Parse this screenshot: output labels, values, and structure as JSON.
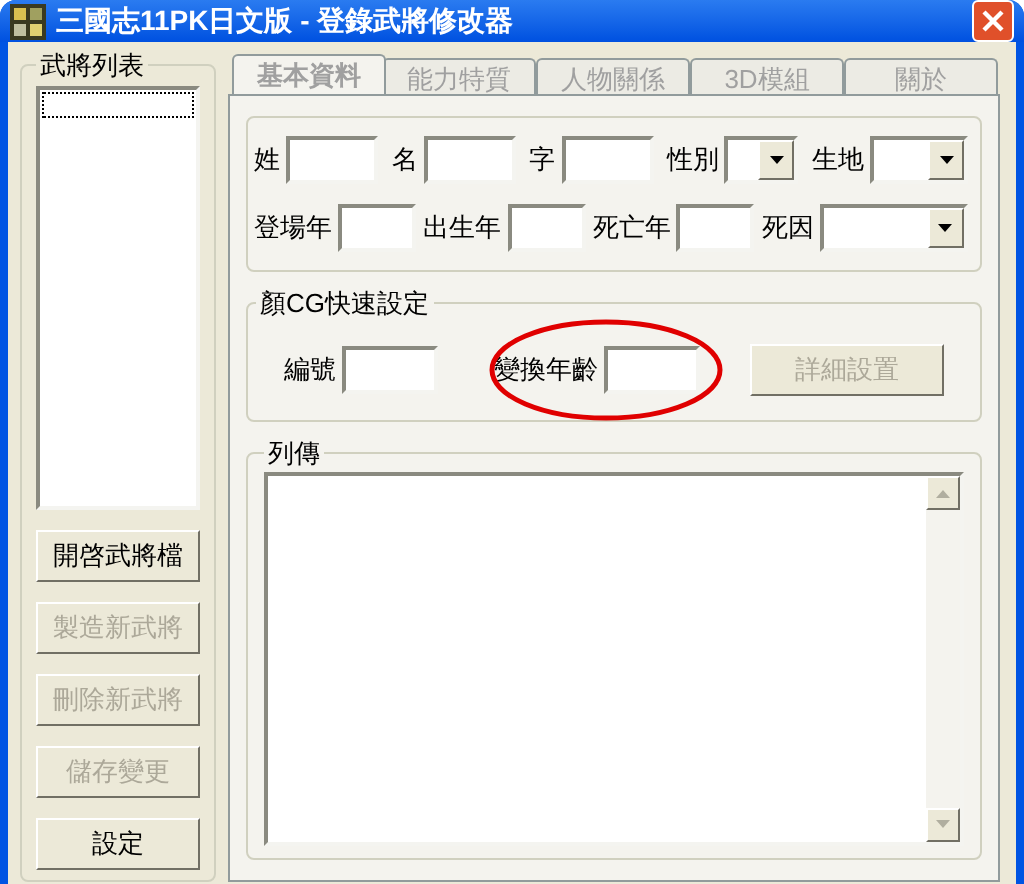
{
  "window": {
    "title": "三國志11PK日文版 - 登錄武將修改器"
  },
  "general_list": {
    "title": "武將列表"
  },
  "side_buttons": [
    {
      "label": "開啓武將檔",
      "disabled": false
    },
    {
      "label": "製造新武將",
      "disabled": true
    },
    {
      "label": "刪除新武將",
      "disabled": true
    },
    {
      "label": "儲存變更",
      "disabled": true
    },
    {
      "label": "設定",
      "disabled": false
    }
  ],
  "tabs": [
    {
      "label": "基本資料",
      "selected": true,
      "disabled": true
    },
    {
      "label": "能力特質",
      "selected": false,
      "disabled": true
    },
    {
      "label": "人物關係",
      "selected": false,
      "disabled": true
    },
    {
      "label": "3D模組",
      "selected": false,
      "disabled": true
    },
    {
      "label": "關於",
      "selected": false,
      "disabled": true
    }
  ],
  "basic_rows": [
    [
      {
        "label": "姓",
        "kind": "text"
      },
      {
        "label": "名",
        "kind": "text"
      },
      {
        "label": "字",
        "kind": "text"
      },
      {
        "label": "性別",
        "kind": "dropdown"
      },
      {
        "label": "生地",
        "kind": "dropdown"
      }
    ],
    [
      {
        "label": "登場年",
        "kind": "text"
      },
      {
        "label": "出生年",
        "kind": "text"
      },
      {
        "label": "死亡年",
        "kind": "text"
      },
      {
        "label": "死因",
        "kind": "dropdown"
      }
    ]
  ],
  "face_cg": {
    "title": "顏CG快速設定",
    "fields": [
      {
        "label": "編號"
      },
      {
        "label": "變換年齡"
      }
    ],
    "button": {
      "label": "詳細設置",
      "disabled": true
    }
  },
  "biography": {
    "title": "列傳"
  },
  "annotation": {
    "kind": "ellipse"
  }
}
